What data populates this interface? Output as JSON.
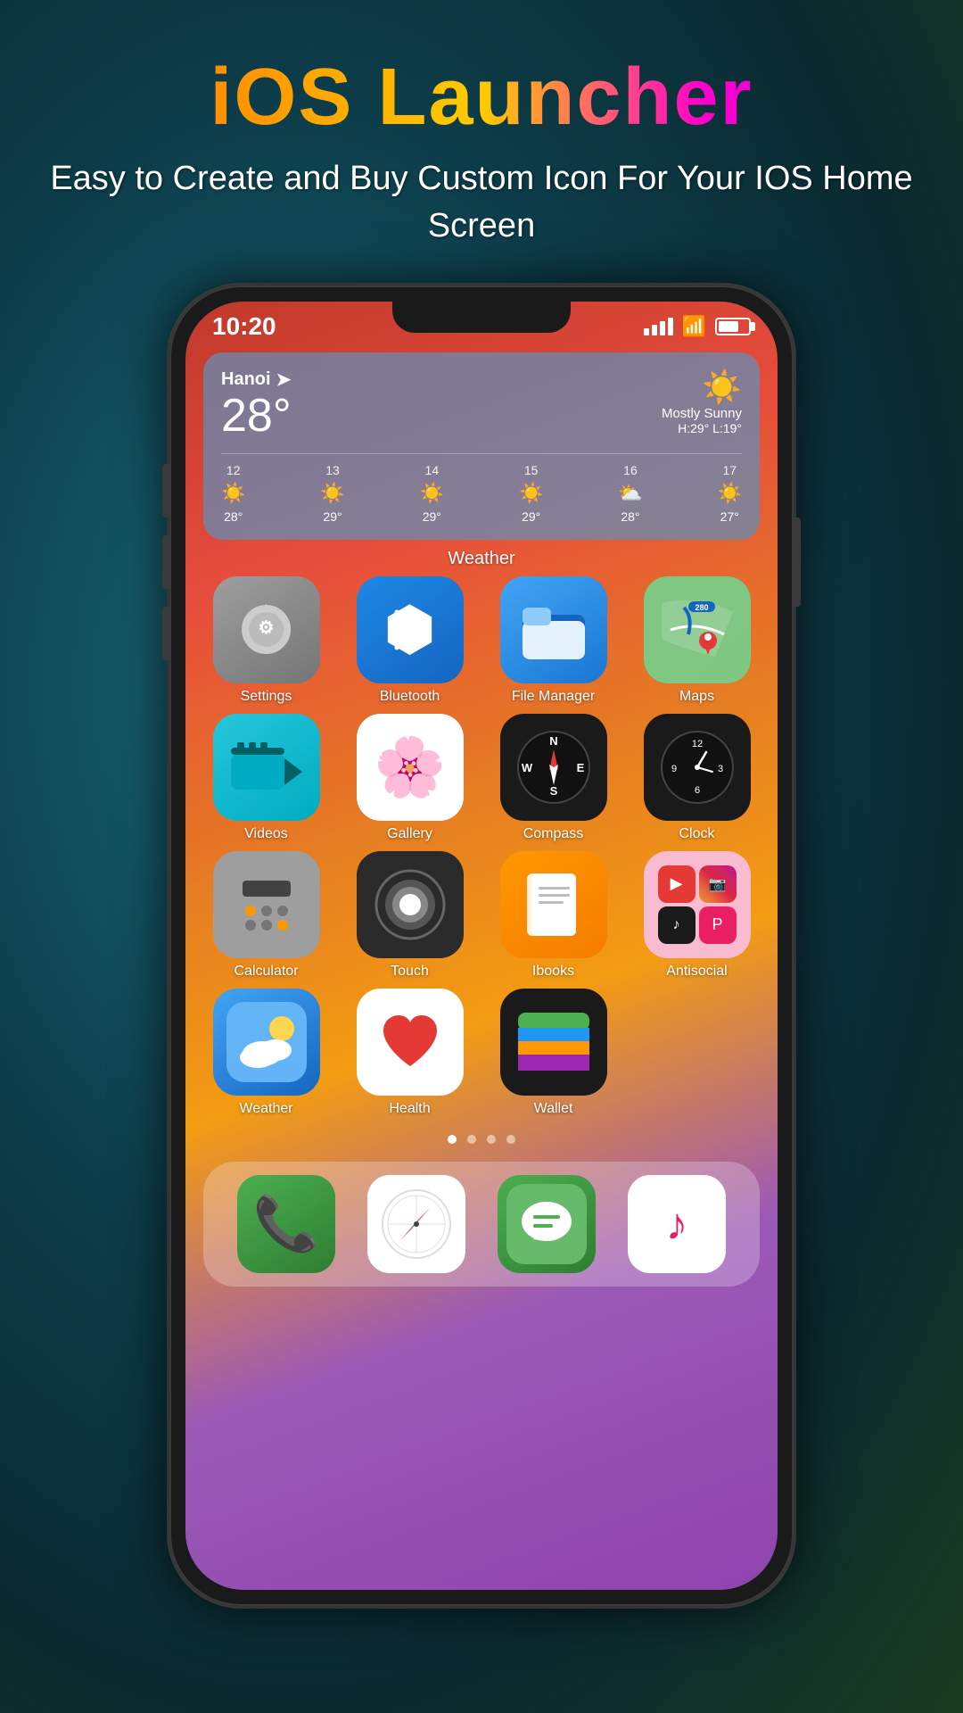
{
  "header": {
    "title": "iOS Launcher",
    "subtitle": "Easy to Create and Buy Custom Icon For Your IOS Home Screen"
  },
  "statusBar": {
    "time": "10:20",
    "battery": "70"
  },
  "weatherWidget": {
    "city": "Hanoi",
    "temperature": "28°",
    "condition": "Mostly Sunny",
    "high": "H:29°",
    "low": "L:19°",
    "forecast": [
      {
        "day": "12",
        "icon": "☀️",
        "temp": "28°"
      },
      {
        "day": "13",
        "icon": "☀️",
        "temp": "29°"
      },
      {
        "day": "14",
        "icon": "☀️",
        "temp": "29°"
      },
      {
        "day": "15",
        "icon": "☀️",
        "temp": "29°"
      },
      {
        "day": "16",
        "icon": "⛅",
        "temp": "28°"
      },
      {
        "day": "17",
        "icon": "☀️",
        "temp": "27°"
      }
    ]
  },
  "sectionLabel": "Weather",
  "apps": [
    {
      "id": "settings",
      "label": "Settings"
    },
    {
      "id": "bluetooth",
      "label": "Bluetooth"
    },
    {
      "id": "filemanager",
      "label": "File Manager"
    },
    {
      "id": "maps",
      "label": "Maps"
    },
    {
      "id": "videos",
      "label": "Videos"
    },
    {
      "id": "gallery",
      "label": "Gallery"
    },
    {
      "id": "compass",
      "label": "Compass"
    },
    {
      "id": "clock",
      "label": "Clock"
    },
    {
      "id": "calculator",
      "label": "Calculator"
    },
    {
      "id": "touch",
      "label": "Touch"
    },
    {
      "id": "ibooks",
      "label": "Ibooks"
    },
    {
      "id": "antisocial",
      "label": "Antisocial"
    },
    {
      "id": "weather",
      "label": "Weather"
    },
    {
      "id": "health",
      "label": "Health"
    },
    {
      "id": "wallet",
      "label": "Wallet"
    }
  ],
  "dockApps": [
    {
      "id": "phone",
      "label": "Phone"
    },
    {
      "id": "safari",
      "label": "Safari"
    },
    {
      "id": "messages",
      "label": "Messages"
    },
    {
      "id": "music",
      "label": "Music"
    }
  ],
  "pageDots": [
    true,
    false,
    false,
    false
  ]
}
